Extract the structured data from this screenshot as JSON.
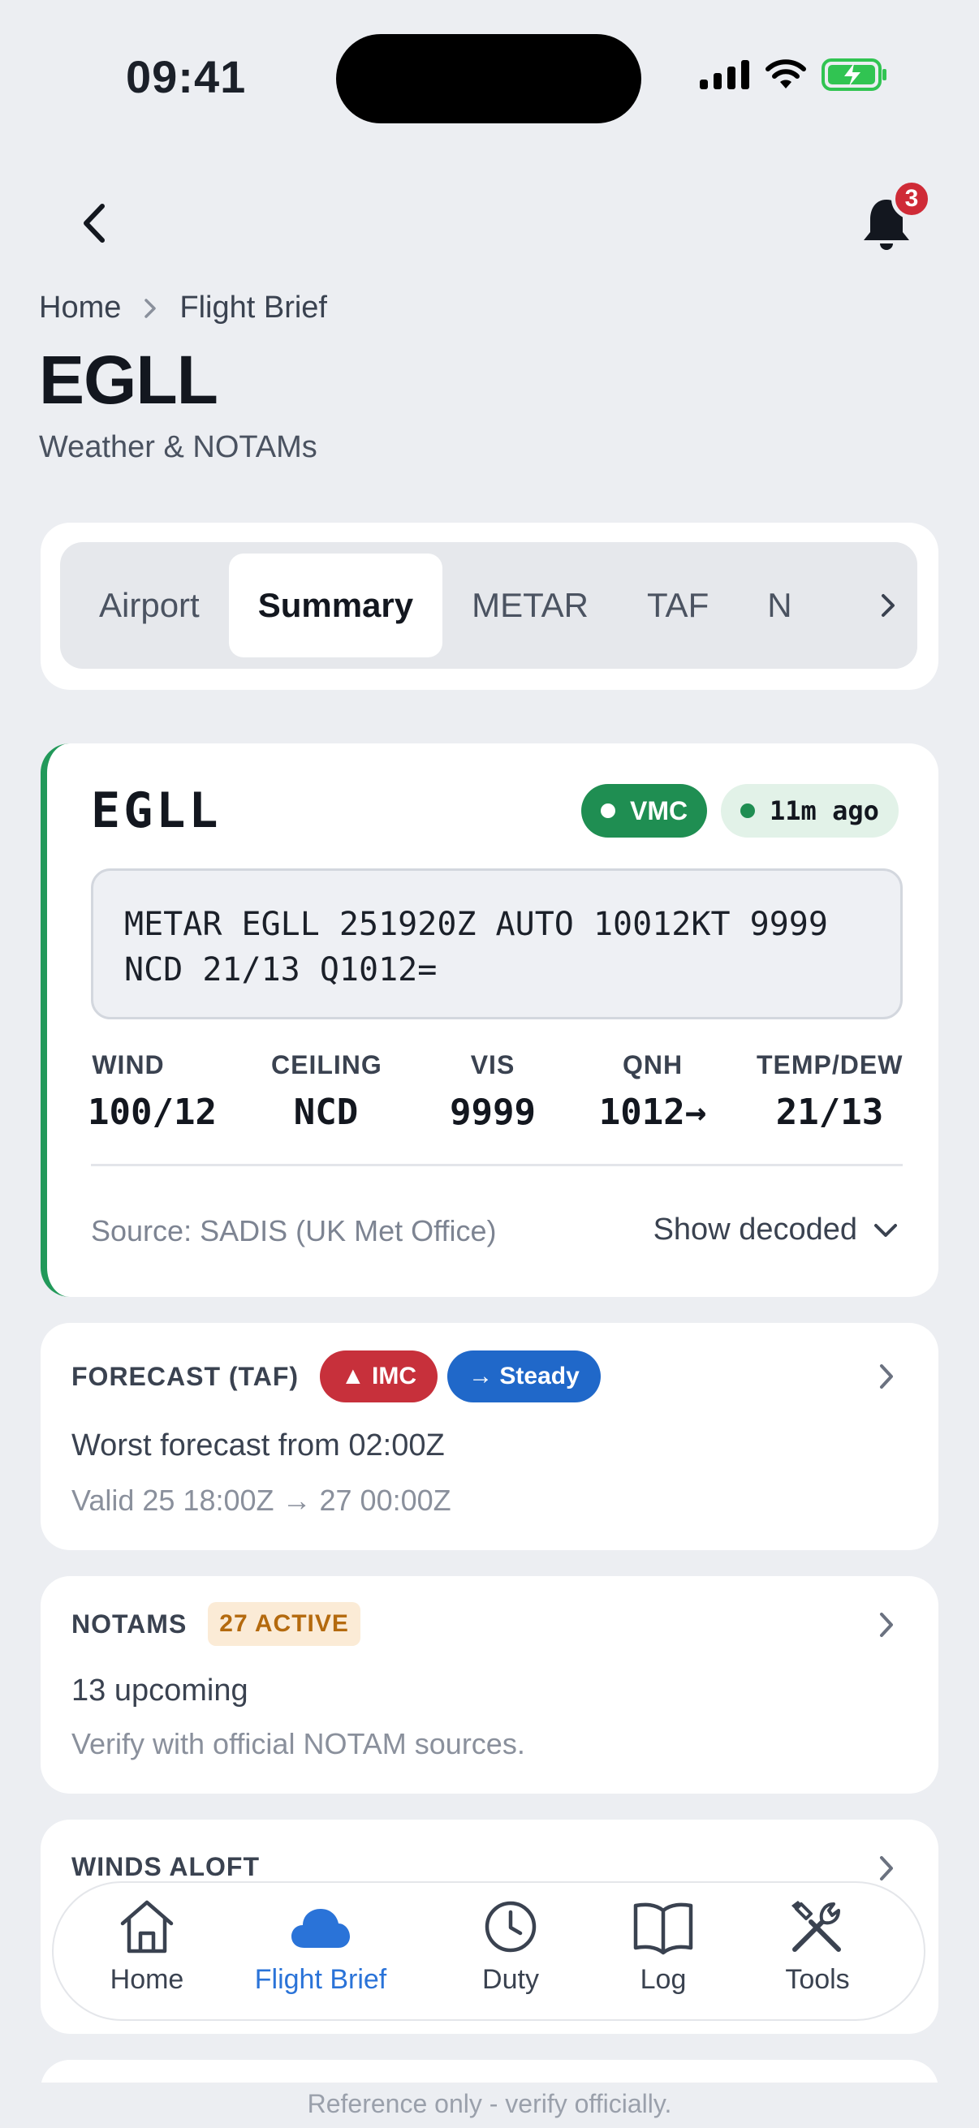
{
  "status_bar": {
    "time": "09:41"
  },
  "header": {
    "notification_count": "3"
  },
  "breadcrumb": {
    "home": "Home",
    "current": "Flight Brief"
  },
  "page": {
    "title": "EGLL",
    "subtitle": "Weather & NOTAMs"
  },
  "tabs": [
    {
      "label": "Airport",
      "active": false
    },
    {
      "label": "Summary",
      "active": true
    },
    {
      "label": "METAR",
      "active": false
    },
    {
      "label": "TAF",
      "active": false
    },
    {
      "label": "N",
      "active": false
    }
  ],
  "metar": {
    "station": "EGLL",
    "flight_category": "VMC",
    "age": "11m ago",
    "raw_line1": "METAR EGLL 251920Z AUTO 10012KT 9999",
    "raw_line2": "NCD 21/13 Q1012=",
    "metrics": [
      {
        "label": "WIND",
        "value": "100/12"
      },
      {
        "label": "CEILING",
        "value": "NCD"
      },
      {
        "label": "VIS",
        "value": "9999"
      },
      {
        "label": "QNH",
        "value": "1012→"
      },
      {
        "label": "TEMP/DEW",
        "value": "21/13"
      }
    ],
    "source": "Source: SADIS (UK Met Office)",
    "decoded_toggle": "Show decoded"
  },
  "forecast": {
    "label": "FORECAST (TAF)",
    "category_chip": "▲ IMC",
    "trend_chip": "→ Steady",
    "main": "Worst forecast from 02:00Z",
    "sub": "Valid 25 18:00Z → 27 00:00Z"
  },
  "notams": {
    "label": "NOTAMS",
    "active_chip": "27 ACTIVE",
    "main": "13 upcoming",
    "sub": "Verify with official NOTAM sources."
  },
  "winds_aloft": {
    "label": "WINDS ALOFT"
  },
  "bottom_nav": [
    {
      "label": "Home",
      "icon": "home-icon",
      "active": false
    },
    {
      "label": "Flight Brief",
      "icon": "cloud-icon",
      "active": true
    },
    {
      "label": "Duty",
      "icon": "clock-icon",
      "active": false
    },
    {
      "label": "Log",
      "icon": "book-icon",
      "active": false
    },
    {
      "label": "Tools",
      "icon": "tools-icon",
      "active": false
    }
  ],
  "footer": {
    "note": "Reference only - verify officially."
  },
  "colors": {
    "vmc_green": "#1f8e52",
    "imc_red": "#c7303b",
    "steady_blue": "#2068c9",
    "active_nav": "#2a73d8",
    "notam_amber": "#b46a0e"
  }
}
